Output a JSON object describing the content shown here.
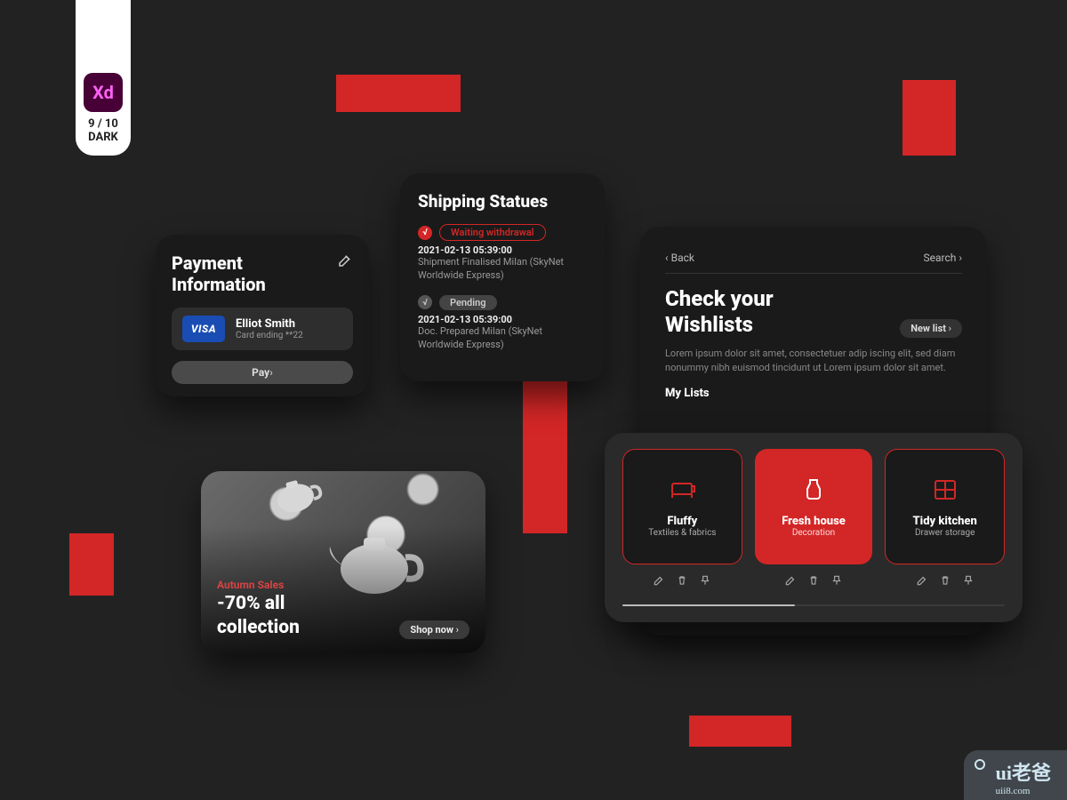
{
  "badge": {
    "logo": "Xd",
    "line1": "9 / 10",
    "line2": "DARK"
  },
  "payment": {
    "title": "Payment Information",
    "holder": "Elliot Smith",
    "sub": "Card ending **22",
    "brand": "VISA",
    "pay": "Pay"
  },
  "shipping": {
    "title": "Shipping Statues",
    "items": [
      {
        "badge": "√",
        "status": "Waiting withdrawal",
        "date": "2021-02-13  05:39:00",
        "desc": "Shipment Finalised Milan (SkyNet Worldwide Express)",
        "active": true
      },
      {
        "badge": "√",
        "status": "Pending",
        "date": "2021-02-13  05:39:00",
        "desc": "Doc. Prepared Milan (SkyNet Worldwide Express)",
        "active": false
      }
    ]
  },
  "promo": {
    "tag": "Autumn Sales",
    "headline1": "-70% all",
    "headline2": "collection",
    "cta": "Shop now"
  },
  "wishlist": {
    "back": "Back",
    "search": "Search",
    "title1": "Check your",
    "title2": "Wishlists",
    "newlist": "New list",
    "desc": "Lorem ipsum dolor sit amet, consectetuer adip iscing elit, sed diam nonummy nibh euismod tincidunt ut Lorem ipsum dolor sit amet.",
    "section": "My Lists",
    "tiles": [
      {
        "name": "Fluffy",
        "sub": "Textiles & fabrics"
      },
      {
        "name": "Fresh house",
        "sub": "Decoration"
      },
      {
        "name": "Tidy kitchen",
        "sub": "Drawer storage"
      }
    ]
  },
  "watermark": {
    "big": "ui老爸",
    "small": "uii8.com"
  }
}
